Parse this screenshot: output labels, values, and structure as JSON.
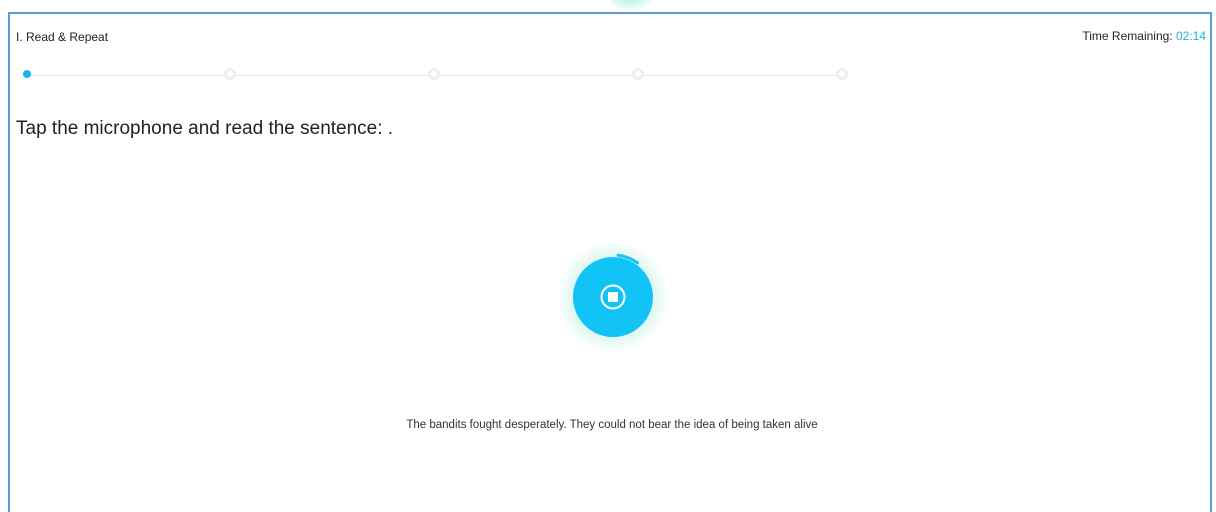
{
  "header": {
    "section_title": "I. Read & Repeat",
    "timer_label": "Time Remaining: ",
    "timer_value": "02:14"
  },
  "stepper": {
    "total_steps": 5,
    "current_step": 1
  },
  "instruction": "Tap the microphone and read the sentence: .",
  "sentence": "The bandits fought desperately. They could not bear the idea of being taken alive",
  "recorder": {
    "state": "recording",
    "icon": "stop-icon",
    "progress_fraction": 0.08
  },
  "colors": {
    "accent": "#12c4f5",
    "timer": "#1ab4e8",
    "frame_border": "#5b9bd5",
    "halo": "#d2f5eb"
  }
}
